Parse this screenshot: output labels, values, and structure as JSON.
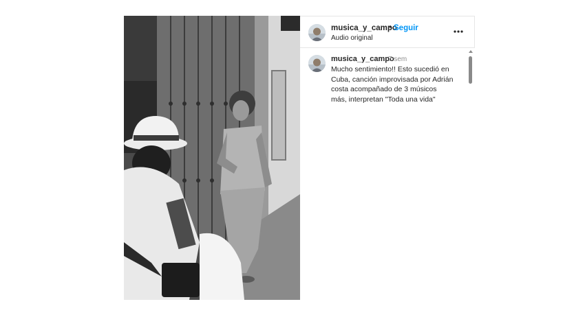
{
  "post": {
    "header": {
      "username": "musica_y_campo",
      "separator": "•",
      "follow_label": "Seguir",
      "audio_label": "Audio original",
      "more_icon": "more-horizontal-icon"
    },
    "comments": [
      {
        "username": "musica_y_campo",
        "time": "7 sem",
        "text": "Mucho sentimiento!! Esto sucedió en Cuba, canción improvisada por Adrián costa acompañado de 3 músicos más, interpretan \"Toda una vida\""
      }
    ],
    "colors": {
      "follow": "#0095f6",
      "timestamp": "#8e8e8e",
      "border": "#e6e6e6"
    }
  }
}
